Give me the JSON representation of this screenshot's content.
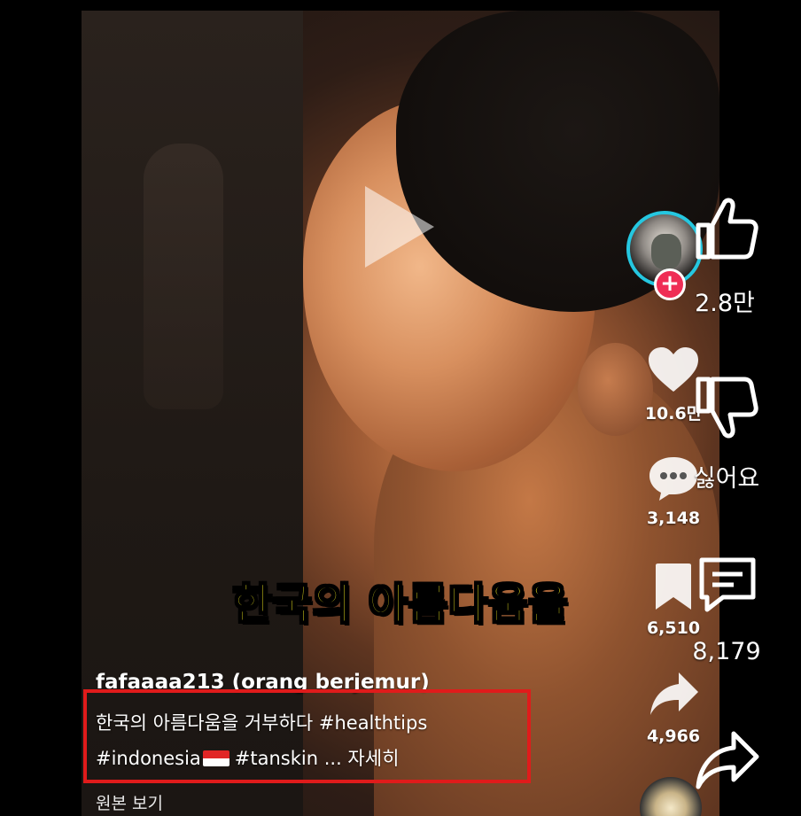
{
  "video": {
    "subtitle": "한국의 아름다움을",
    "username": "fafaaaa213 (orang berjemur)",
    "caption_line1": "한국의 아름다움을 거부하다 #healthtips",
    "caption_line2_a": "#indonesia",
    "caption_line2_b": "#tanskin ... 자세히",
    "view_original": "원본 보기",
    "highlight_color": "#e01b1b",
    "subtitle_color": "#f2ea1f"
  },
  "tiktok_rail": {
    "likes": "10.6만",
    "comments": "3,148",
    "saves": "6,510",
    "shares": "4,966",
    "follow_symbol": "+"
  },
  "actions": {
    "like_count": "2.8만",
    "dislike_label": "싫어요",
    "comment_count": "8,179"
  },
  "icons": [
    "play-icon",
    "thumbs-up-icon",
    "thumbs-down-icon",
    "comment-icon",
    "share-icon",
    "heart-icon",
    "dots-comment-icon",
    "bookmark-icon",
    "share-arrow-icon",
    "music-disc-icon"
  ]
}
